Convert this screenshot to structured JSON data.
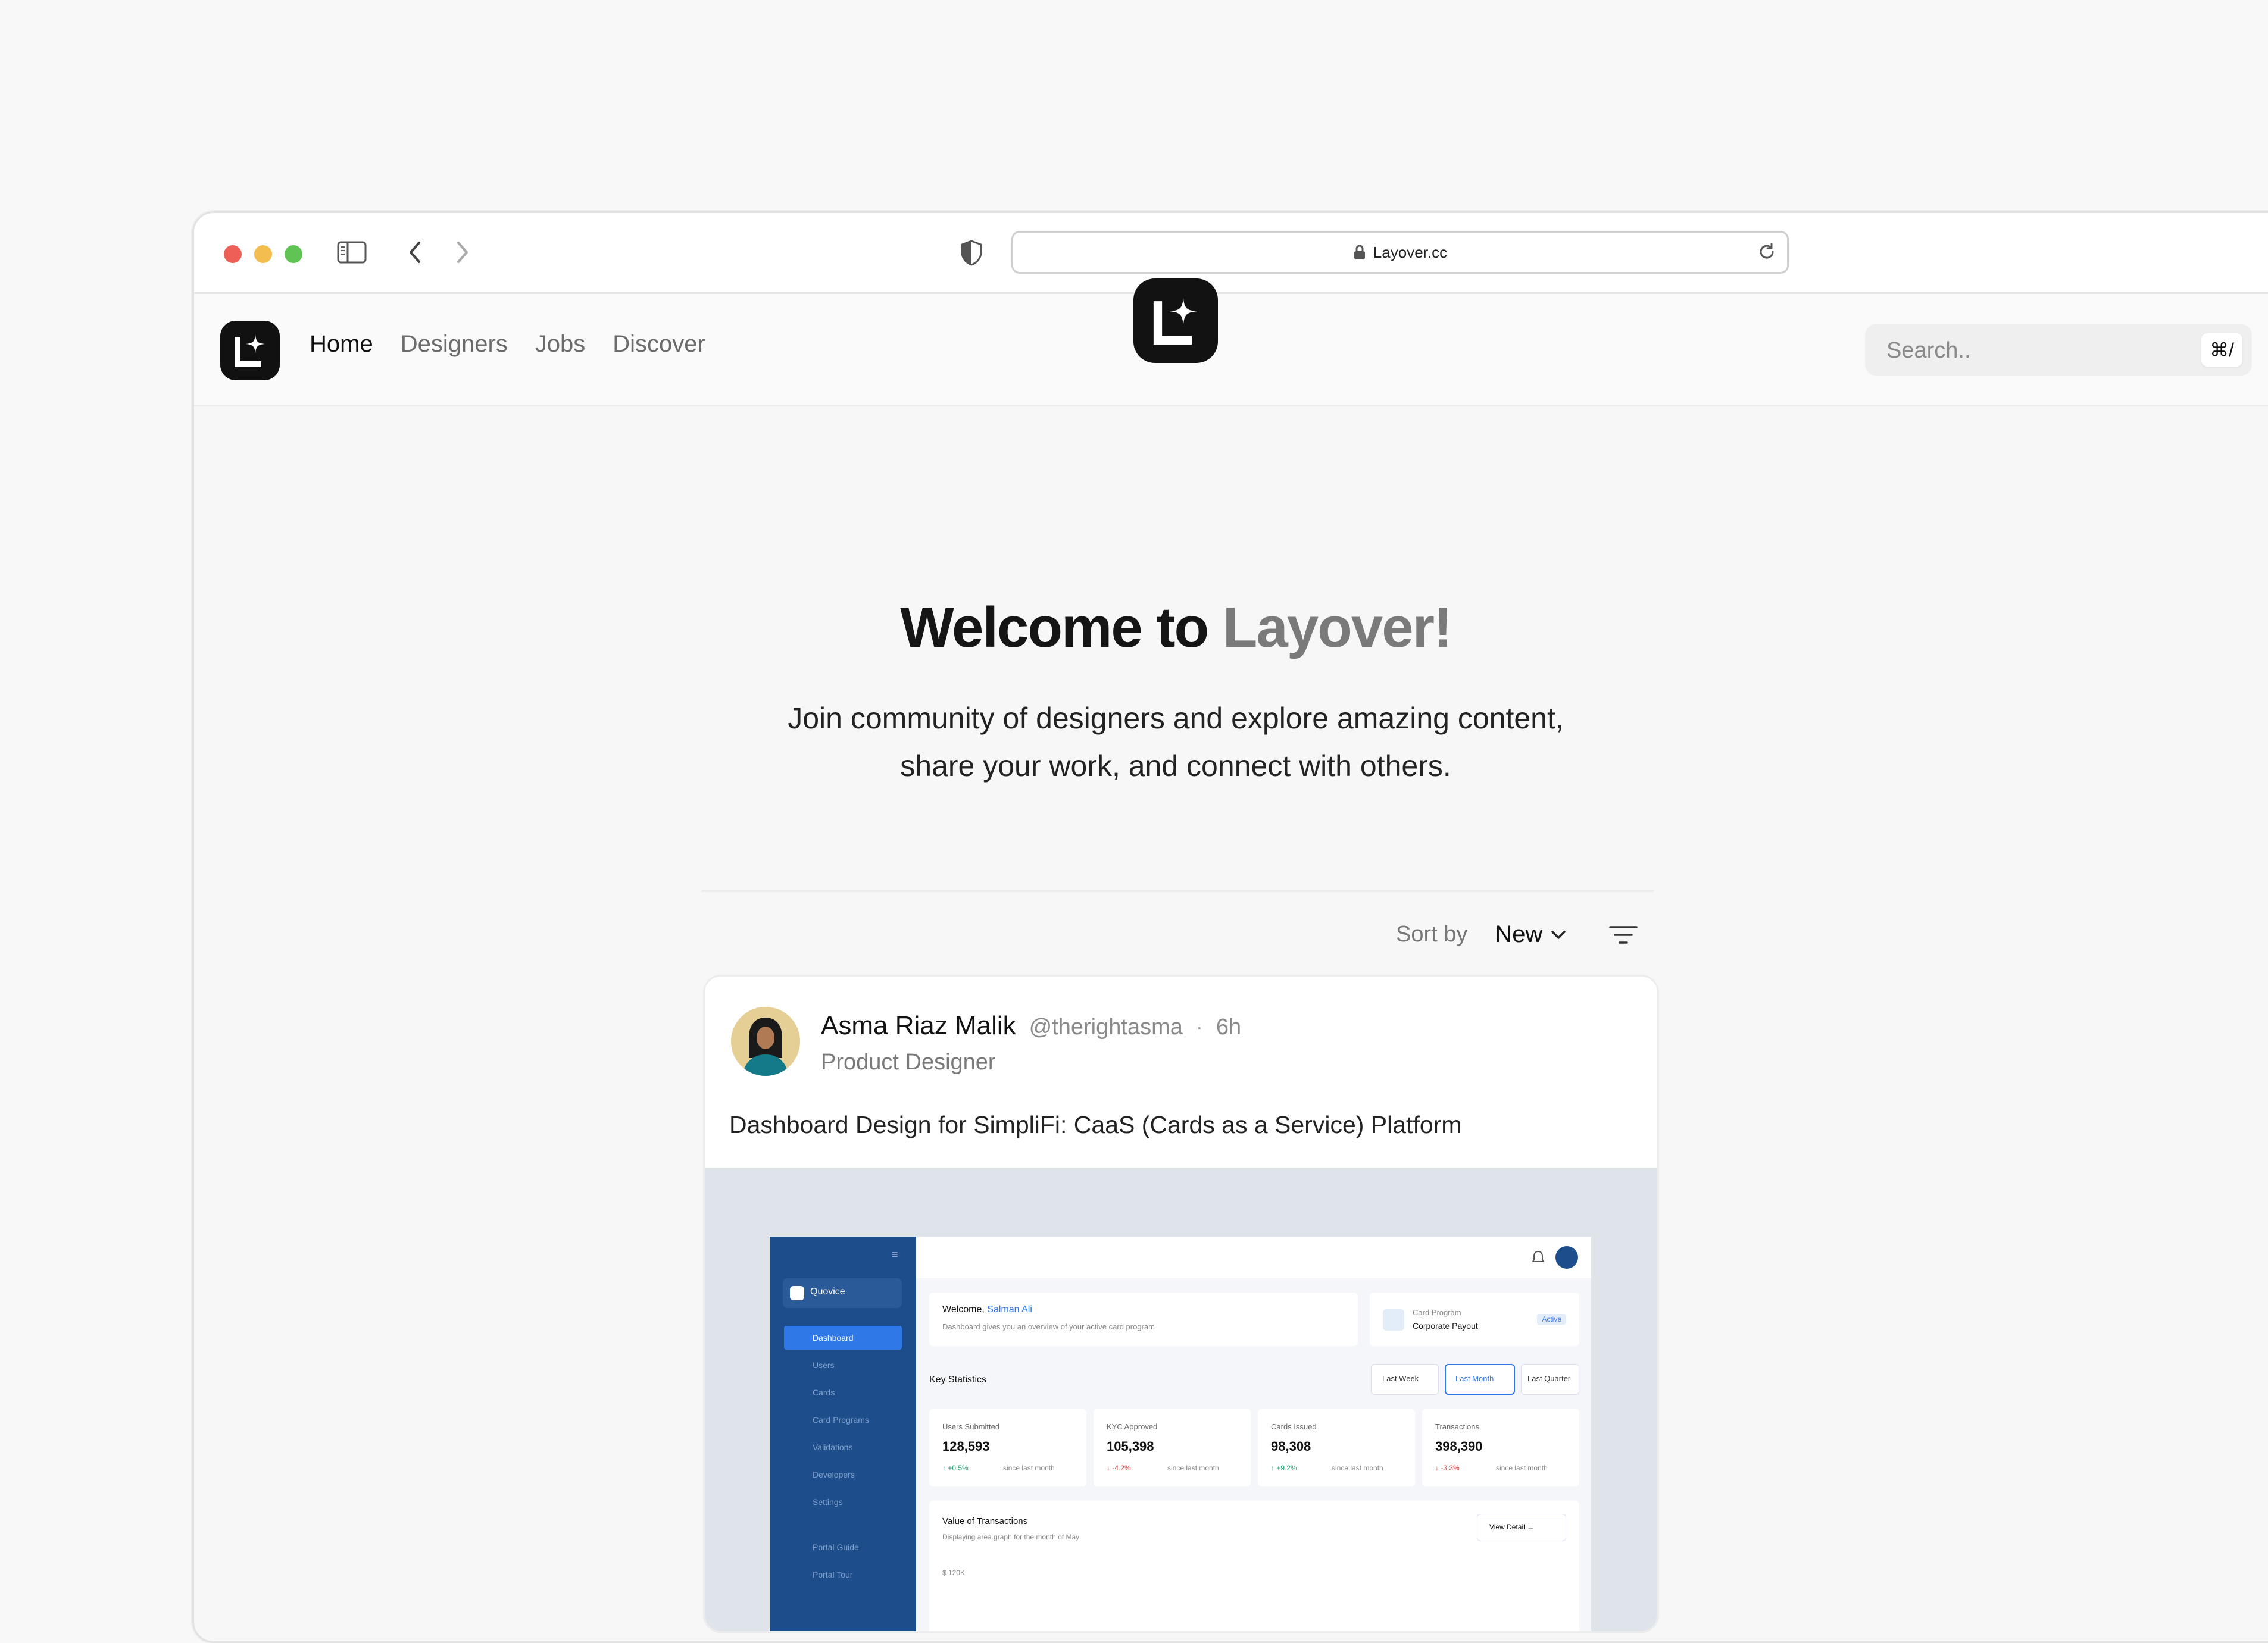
{
  "browser": {
    "url": "Layover.cc"
  },
  "site": {
    "nav": [
      "Home",
      "Designers",
      "Jobs",
      "Discover"
    ],
    "search_placeholder": "Search..",
    "search_shortcut": "⌘/"
  },
  "hero": {
    "title_prefix": "Welcome to ",
    "title_brand": "Layover!",
    "subtitle_line1": "Join community of designers and explore amazing content,",
    "subtitle_line2": "share your work, and connect with others."
  },
  "feed": {
    "sort_label": "Sort by",
    "sort_value": "New"
  },
  "post": {
    "author": "Asma Riaz Malik",
    "handle": "@therightasma",
    "separator": "·",
    "time": "6h",
    "role": "Product Designer",
    "title": "Dashboard Design for SimpliFi: CaaS (Cards as a Service) Platform"
  },
  "mock": {
    "brand": "Quovice",
    "menu": [
      "Dashboard",
      "Users",
      "Cards",
      "Card Programs",
      "Validations",
      "Developers",
      "Settings",
      "Portal Guide",
      "Portal Tour"
    ],
    "welcome": "Welcome,",
    "user": "Salman Ali",
    "welcome_sub": "Dashboard gives you an overview of your active card program",
    "program_label": "Card Program",
    "program_name": "Corporate Payout",
    "program_status": "Active",
    "stats_title": "Key Statistics",
    "ranges": [
      "Last Week",
      "Last Month",
      "Last Quarter"
    ],
    "stats": [
      {
        "label": "Users Submitted",
        "value": "128,593",
        "change": "+0.5%",
        "note": "since last month"
      },
      {
        "label": "KYC Approved",
        "value": "105,398",
        "change": "-4.2%",
        "note": "since last month"
      },
      {
        "label": "Cards Issued",
        "value": "98,308",
        "change": "+9.2%",
        "note": "since last month"
      },
      {
        "label": "Transactions",
        "value": "398,390",
        "change": "-3.3%",
        "note": "since last month"
      }
    ],
    "txn_title": "Value of Transactions",
    "txn_sub": "Displaying area graph for the month of May",
    "view_detail": "View Detail",
    "y_tick": "$ 120K"
  },
  "colors": {
    "accent": "#2f78e8",
    "sidebar": "#1e4d8b",
    "positive": "#22a06b",
    "negative": "#d64545"
  }
}
